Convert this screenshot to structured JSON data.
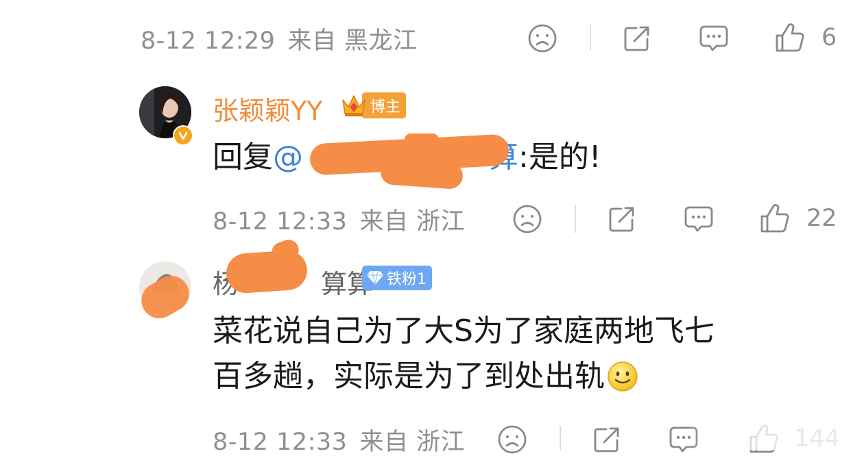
{
  "comments": [
    {
      "id": "c0",
      "date": "8-12 12:29",
      "source": "来自 黑龙江",
      "likes": "6"
    },
    {
      "id": "c1",
      "user": {
        "name": "张颖颖YY",
        "badge": "博主"
      },
      "reply_prefix": "回复",
      "mention": "@",
      "mention_suffix": "算",
      "reply_text": ":是的!",
      "date": "8-12 12:33",
      "source": "来自 浙江",
      "likes": "22"
    },
    {
      "id": "c2",
      "user": {
        "name_start": "杨",
        "name_end": "算算",
        "badge": "铁粉1"
      },
      "text_line1": "菜花说自己为了大S为了家庭两地飞七",
      "text_line2": "百多趟，实际是为了到处出轨",
      "date": "8-12 12:33",
      "source": "来自 浙江",
      "likes": "144"
    }
  ],
  "icons": {
    "dislike": "sad-face-icon",
    "share": "share-icon",
    "comment": "comment-icon",
    "like": "thumbs-up-icon",
    "emoji": "smile-emoji-icon",
    "verified": "verified-v-icon",
    "crown": "crown-icon",
    "diamond": "diamond-icon"
  },
  "colors": {
    "name_vip": "#f28c3a",
    "meta": "#8f8f8f",
    "mention": "#3f84d6",
    "redaction": "#f58d47",
    "badge_blogger": "#f3a23a",
    "badge_fan": "#6fa8f2"
  }
}
